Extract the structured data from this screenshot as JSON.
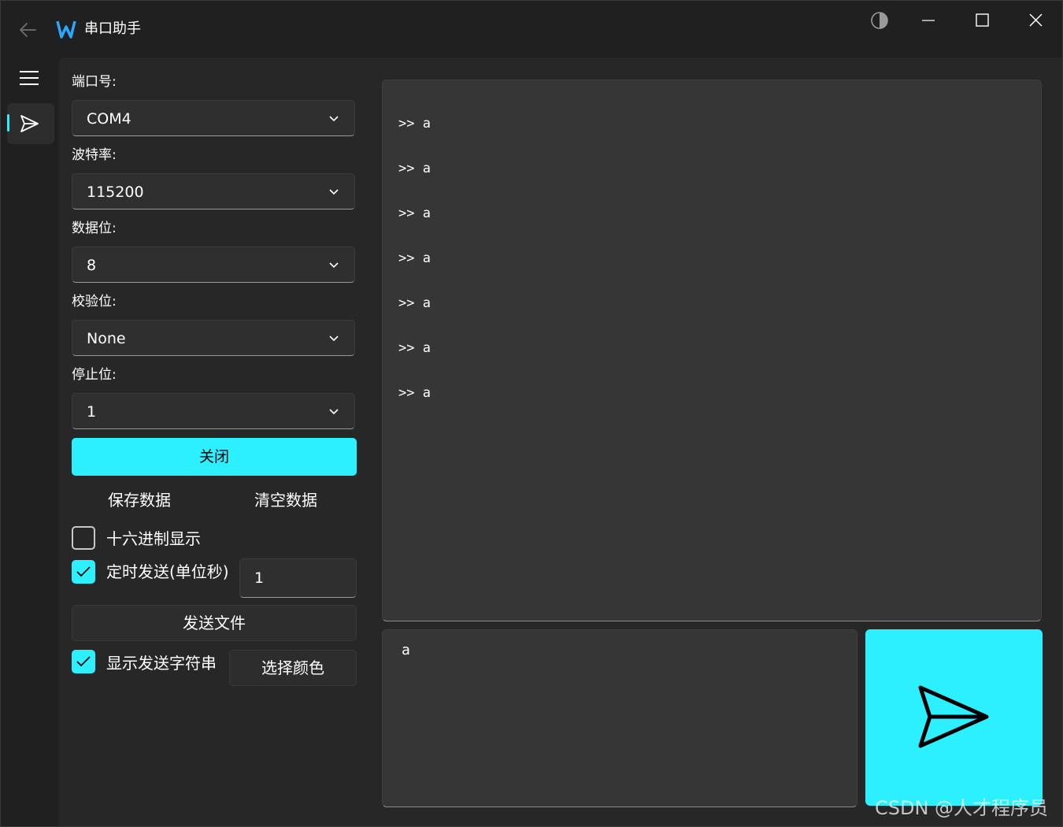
{
  "window": {
    "title": "串口助手"
  },
  "serial_config": {
    "port": {
      "label": "端口号:",
      "value": "COM4"
    },
    "baud_rate": {
      "label": "波特率:",
      "value": "115200"
    },
    "data_bits": {
      "label": "数据位:",
      "value": "8"
    },
    "parity": {
      "label": "校验位:",
      "value": "None"
    },
    "stop_bits": {
      "label": "停止位:",
      "value": "1"
    }
  },
  "actions": {
    "toggle_port_label": "关闭",
    "save_data_label": "保存数据",
    "clear_data_label": "清空数据",
    "send_file_label": "发送文件",
    "select_color_label": "选择颜色"
  },
  "options": {
    "hex_display": {
      "label": "十六进制显示",
      "checked": false
    },
    "timed_send": {
      "label": "定时发送(单位秒)",
      "checked": true,
      "interval": "1"
    },
    "show_sent_string": {
      "label": "显示发送字符串",
      "checked": true
    }
  },
  "output": {
    "lines": [
      ">> a",
      ">> a",
      ">> a",
      ">> a",
      ">> a",
      ">> a",
      ">> a"
    ]
  },
  "send_input": {
    "value": "a"
  },
  "watermark": "CSDN @人才程序员",
  "colors": {
    "accent": "#2cf0ff",
    "background": "#202020",
    "panel": "#272727",
    "text_box": "#363636"
  },
  "icons": {
    "back": "arrow-left-icon",
    "logo": "w-logo-icon",
    "theme": "half-circle-icon",
    "menu": "hamburger-icon",
    "nav_send": "paper-plane-icon",
    "send": "paper-plane-icon"
  }
}
